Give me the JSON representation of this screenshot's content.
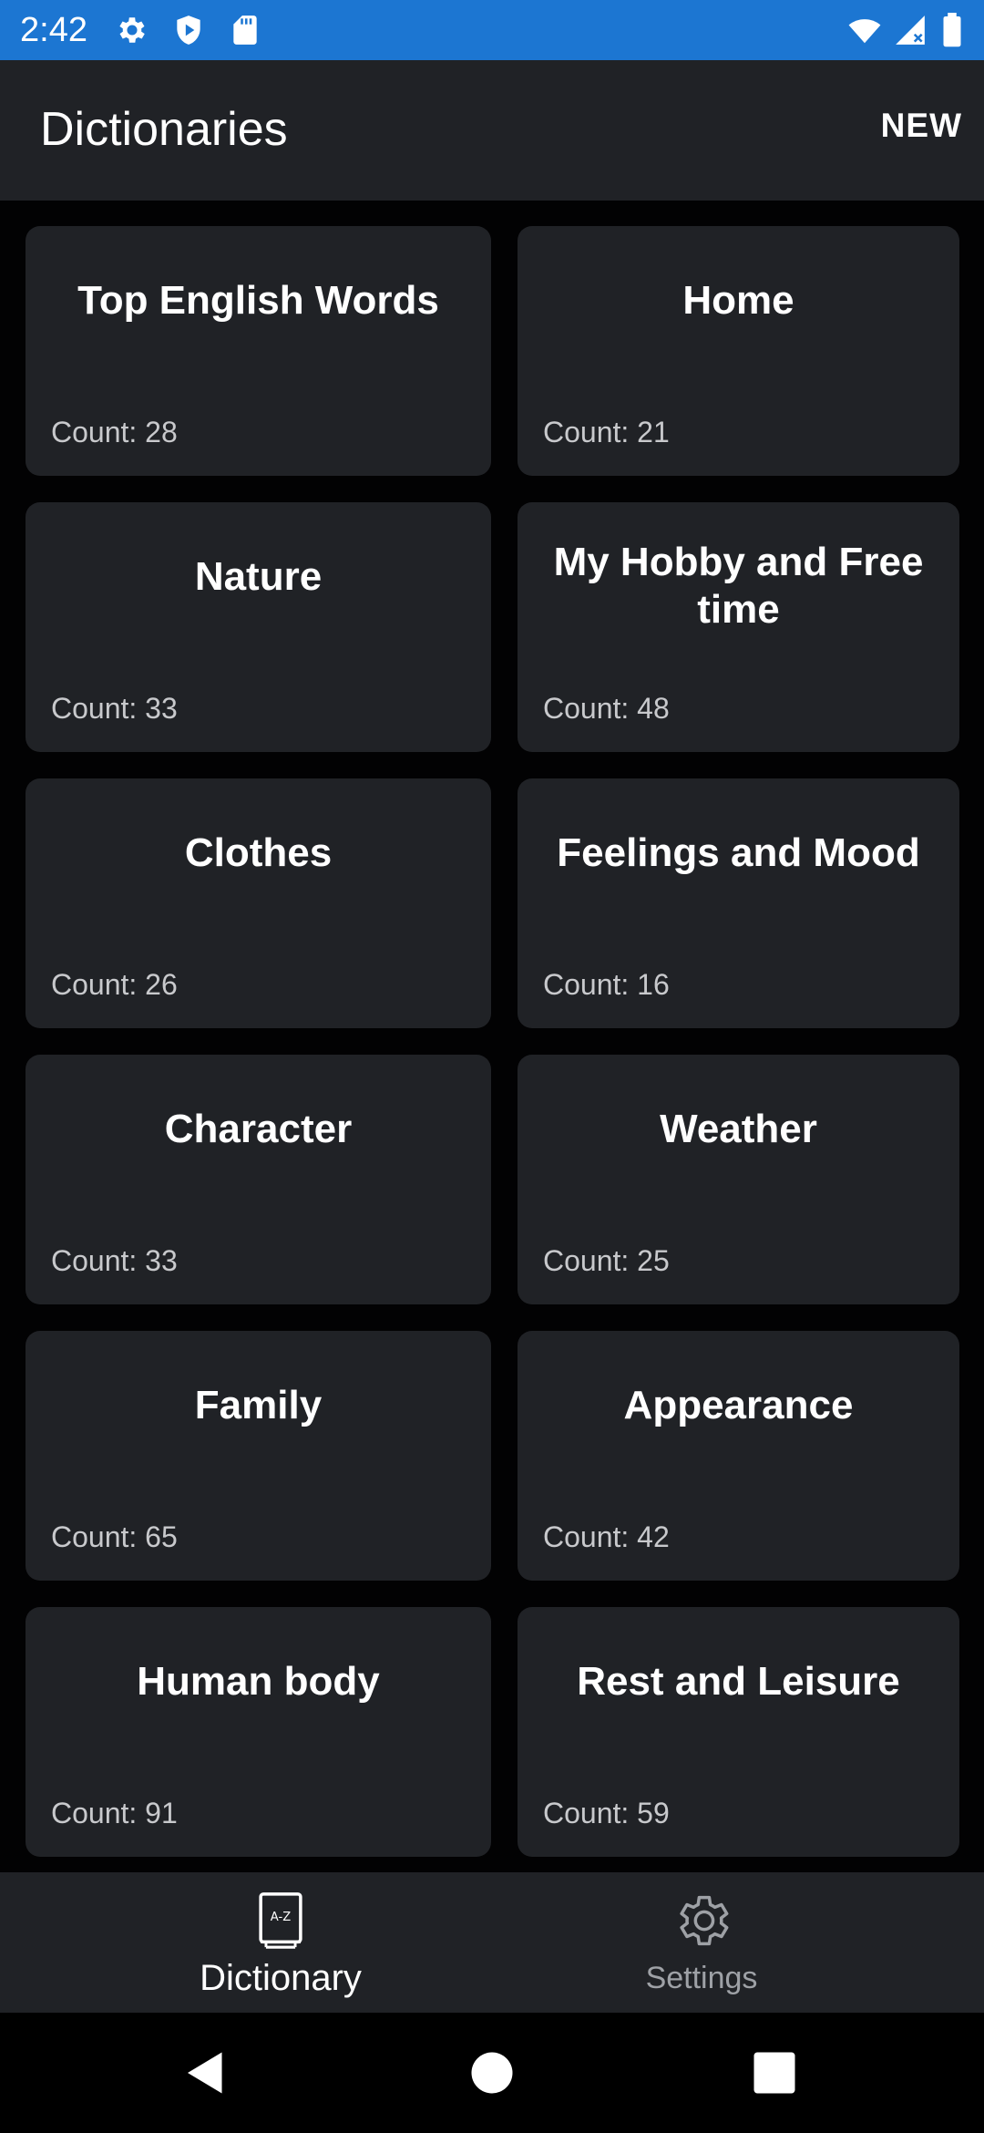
{
  "status_bar": {
    "time": "2:42",
    "background": "#1c76d2",
    "icons": [
      "gear-icon",
      "shield-icon",
      "sd-card-icon",
      "wifi-icon",
      "signal-icon",
      "battery-icon"
    ]
  },
  "app_bar": {
    "title": "Dictionaries",
    "new_label": "NEW"
  },
  "dictionaries": [
    {
      "title": "Top English Words",
      "count": "Count: 28"
    },
    {
      "title": "Home",
      "count": "Count: 21"
    },
    {
      "title": "Nature",
      "count": "Count: 33"
    },
    {
      "title": "My Hobby and Free time",
      "count": "Count: 48"
    },
    {
      "title": "Clothes",
      "count": "Count: 26"
    },
    {
      "title": "Feelings and Mood",
      "count": "Count: 16"
    },
    {
      "title": "Character",
      "count": "Count: 33"
    },
    {
      "title": "Weather",
      "count": "Count: 25"
    },
    {
      "title": "Family",
      "count": "Count: 65"
    },
    {
      "title": "Appearance",
      "count": "Count: 42"
    },
    {
      "title": "Human body",
      "count": "Count: 91"
    },
    {
      "title": "Rest and Leisure",
      "count": "Count: 59"
    }
  ],
  "bottom_nav": {
    "items": [
      {
        "label": "Dictionary",
        "icon": "dictionary-book-icon",
        "active": true
      },
      {
        "label": "Settings",
        "icon": "gear-icon",
        "active": false
      }
    ]
  },
  "system_nav": {
    "icons": [
      "back-icon",
      "home-icon",
      "recents-icon"
    ]
  },
  "colors": {
    "surface": "#202226",
    "background": "#020203",
    "text_primary": "#ffffff",
    "text_secondary": "#c8c9cc",
    "accent_status": "#1c76d2"
  }
}
